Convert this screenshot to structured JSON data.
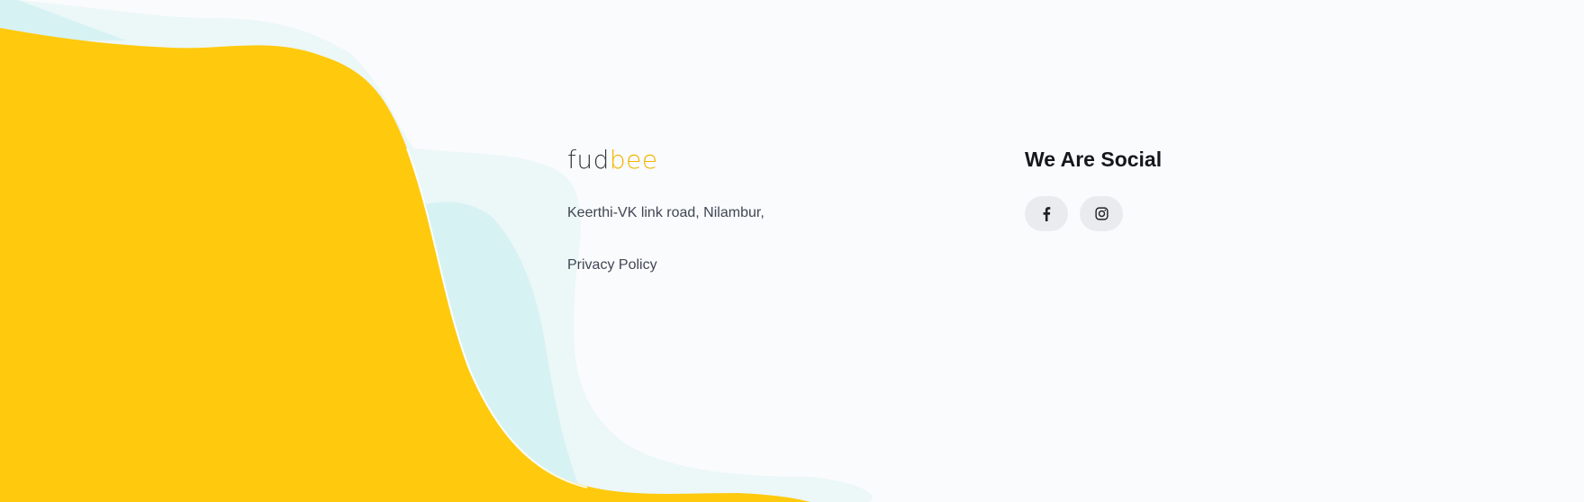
{
  "brand": {
    "logo_part_dark": "fud",
    "logo_part_accent": "bee",
    "address": "Keerthi-VK link road, Nilambur,",
    "privacy_label": "Privacy Policy"
  },
  "social": {
    "title": "We Are Social",
    "links": [
      {
        "icon": "facebook-icon"
      },
      {
        "icon": "instagram-icon"
      }
    ]
  },
  "colors": {
    "background": "#fafbfc",
    "wave_yellow": "#ffca0d",
    "wave_light_blue": "#d7f2f3",
    "wave_pale_blue": "#ecf7f7",
    "logo_accent": "#f4b400",
    "button_bg": "#e9ebee"
  }
}
